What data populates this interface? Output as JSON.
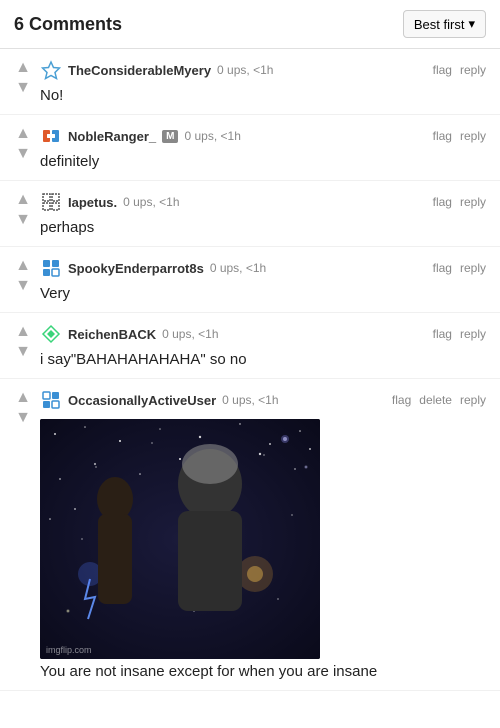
{
  "header": {
    "title": "6 Comments",
    "sort_label": "Best first",
    "sort_arrow": "▼"
  },
  "comments": [
    {
      "id": 1,
      "username": "TheConsiderableMyery",
      "badge": "",
      "meta": "0 ups, <1h",
      "text": "No!",
      "avatar_type": "star",
      "actions": [
        "flag",
        "reply"
      ]
    },
    {
      "id": 2,
      "username": "NobleRanger_",
      "badge": "M",
      "meta": "0 ups, <1h",
      "text": "definitely",
      "avatar_type": "noble",
      "actions": [
        "flag",
        "reply"
      ]
    },
    {
      "id": 3,
      "username": "Iapetus.",
      "badge": "",
      "meta": "0 ups, <1h",
      "text": "perhaps",
      "avatar_type": "iapetus",
      "actions": [
        "flag",
        "reply"
      ]
    },
    {
      "id": 4,
      "username": "SpookyEnderparrot8s",
      "badge": "",
      "meta": "0 ups, <1h",
      "text": "Very",
      "avatar_type": "spooky",
      "actions": [
        "flag",
        "reply"
      ]
    },
    {
      "id": 5,
      "username": "ReichenBACK",
      "badge": "",
      "meta": "0 ups, <1h",
      "text": "i say\"BAHAHAHAHAHA\" so no",
      "avatar_type": "reichen",
      "actions": [
        "flag",
        "reply"
      ]
    },
    {
      "id": 6,
      "username": "OccasionallyActiveUser",
      "badge": "",
      "meta": "0 ups, <1h",
      "text": "You are not insane except for when you are insane",
      "avatar_type": "occasionally",
      "has_image": true,
      "actions": [
        "flag",
        "delete",
        "reply"
      ]
    }
  ],
  "watermark": "imgflip.com"
}
